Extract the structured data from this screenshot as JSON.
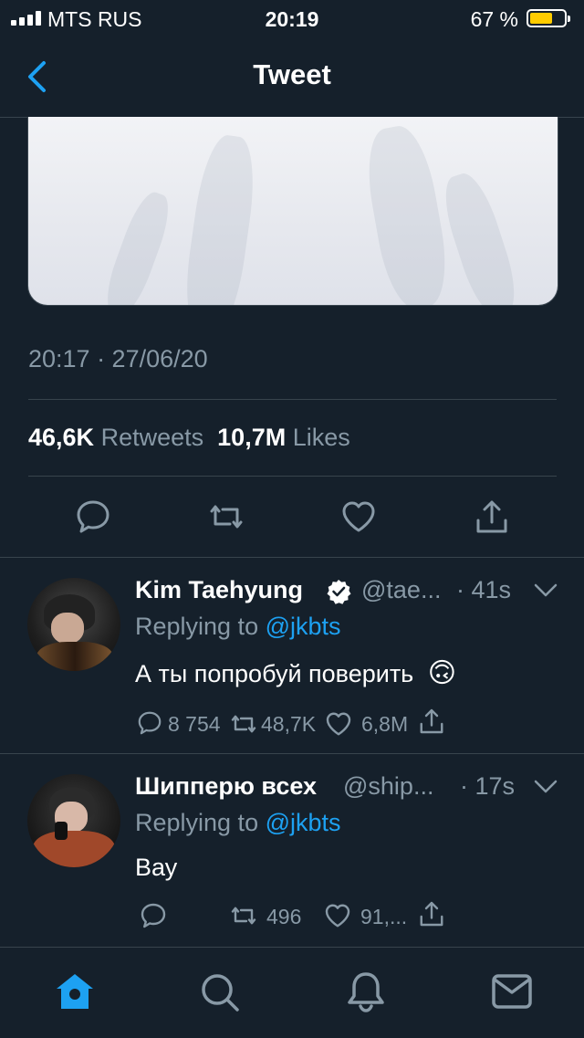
{
  "status_bar": {
    "carrier": "MTS RUS",
    "time": "20:19",
    "battery": "67 %"
  },
  "nav": {
    "title": "Tweet"
  },
  "tweet": {
    "timestamp": "20:17 · 27/06/20",
    "retweets_count": "46,6K",
    "retweets_label": "Retweets",
    "likes_count": "10,7M",
    "likes_label": "Likes"
  },
  "replies": [
    {
      "name": "Kim Taehyung",
      "verified": true,
      "handle": "@tae...",
      "age": "· 41s",
      "replying_prefix": "Replying to",
      "replying_to": "@jkbts",
      "text": "А ты попробуй поверить",
      "emoji": "🙃",
      "replies": "8 754",
      "retweets": "48,7K",
      "likes": "6,8M"
    },
    {
      "name": "Шипперю всех",
      "verified": false,
      "handle": "@ship...",
      "age": "· 17s",
      "replying_prefix": "Replying to",
      "replying_to": "@jkbts",
      "text": "Вау",
      "replies": "",
      "retweets": "496",
      "likes": "91,..."
    }
  ],
  "tabbar": {
    "items": [
      "home-icon",
      "search-icon",
      "notifications-icon",
      "messages-icon"
    ]
  },
  "colors": {
    "background": "#15202b",
    "accent": "#1da1f2",
    "muted": "#8899a6",
    "divider": "#38444d",
    "battery": "#ffcc00"
  }
}
